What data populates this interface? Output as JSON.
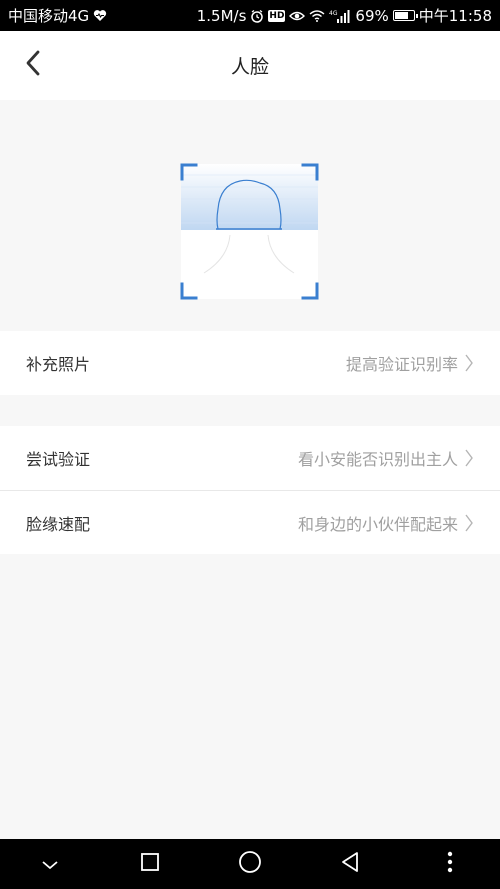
{
  "status_bar": {
    "carrier": "中国移动4G",
    "speed": "1.5M/s",
    "hd": "HD",
    "network": "4G",
    "battery": "69%",
    "battery_level": 0.69,
    "time": "中午11:58"
  },
  "header": {
    "title": "人脸"
  },
  "list_group_1": [
    {
      "label": "补充照片",
      "hint": "提高验证识别率"
    }
  ],
  "list_group_2": [
    {
      "label": "尝试验证",
      "hint": "看小安能否识别出主人"
    },
    {
      "label": "脸缘速配",
      "hint": "和身边的小伙伴配起来"
    }
  ],
  "colors": {
    "accent_blue": "#3a7fd0",
    "hint_gray": "#a0a0a0",
    "background": "#f7f7f7"
  },
  "icons": [
    "back-arrow-icon",
    "face-outline-icon",
    "chevron-right-icon",
    "nav-back-icon",
    "nav-home-icon",
    "nav-recents-icon",
    "nav-collapse-icon",
    "nav-menu-icon"
  ]
}
